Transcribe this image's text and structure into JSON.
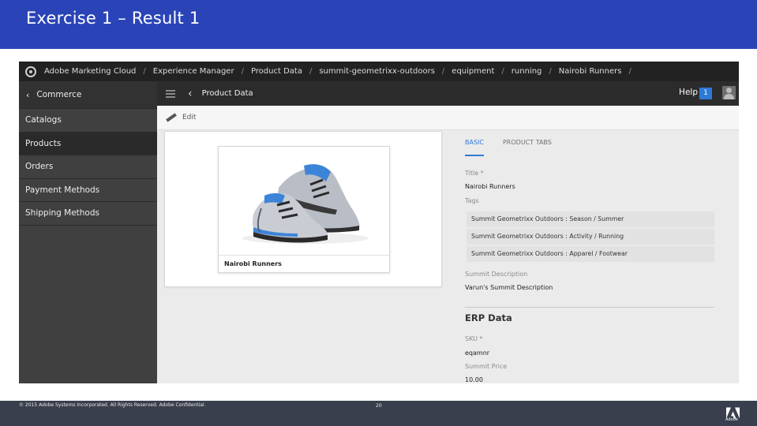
{
  "slide": {
    "title": "Exercise 1 – Result 1",
    "footer": {
      "copyright": "© 2015 Adobe Systems Incorporated. All Rights Reserved. Adobe Confidential.",
      "page_number": "20",
      "logo_text": "Adobe"
    }
  },
  "topbar": {
    "breadcrumbs": [
      "Adobe Marketing Cloud",
      "Experience Manager",
      "Product Data",
      "summit-geometrixx-outdoors",
      "equipment",
      "running",
      "Nairobi Runners"
    ],
    "separator": "/"
  },
  "sidebar": {
    "header": "Commerce",
    "items": [
      {
        "label": "Catalogs",
        "active": false
      },
      {
        "label": "Products",
        "active": true
      },
      {
        "label": "Orders",
        "active": false
      },
      {
        "label": "Payment Methods",
        "active": false
      },
      {
        "label": "Shipping Methods",
        "active": false
      }
    ]
  },
  "actionbar": {
    "page_title": "Product Data",
    "help_label": "Help",
    "notification_count": "1"
  },
  "toolbar": {
    "edit_label": "Edit"
  },
  "asset": {
    "caption": "Nairobi Runners"
  },
  "properties": {
    "tabs": [
      "BASIC",
      "PRODUCT TABS"
    ],
    "active_tab": "BASIC",
    "title_label": "Title *",
    "title_value": "Nairobi Runners",
    "tags_label": "Tags",
    "tags": [
      "Summit Geometrixx Outdoors : Season / Summer",
      "Summit Geometrixx Outdoors : Activity / Running",
      "Summit Geometrixx Outdoors : Apparel / Footwear"
    ],
    "description_label": "Summit Description",
    "description_value": "Varun's Summit Description",
    "erp_section_title": "ERP Data",
    "sku_label": "SKU *",
    "sku_value": "eqamnr",
    "price_label": "Summit Price",
    "price_value": "10.00"
  },
  "colors": {
    "header_blue": "#2a44b8",
    "accent_blue": "#2e79d6",
    "footer_slate": "#3a3f4d"
  }
}
